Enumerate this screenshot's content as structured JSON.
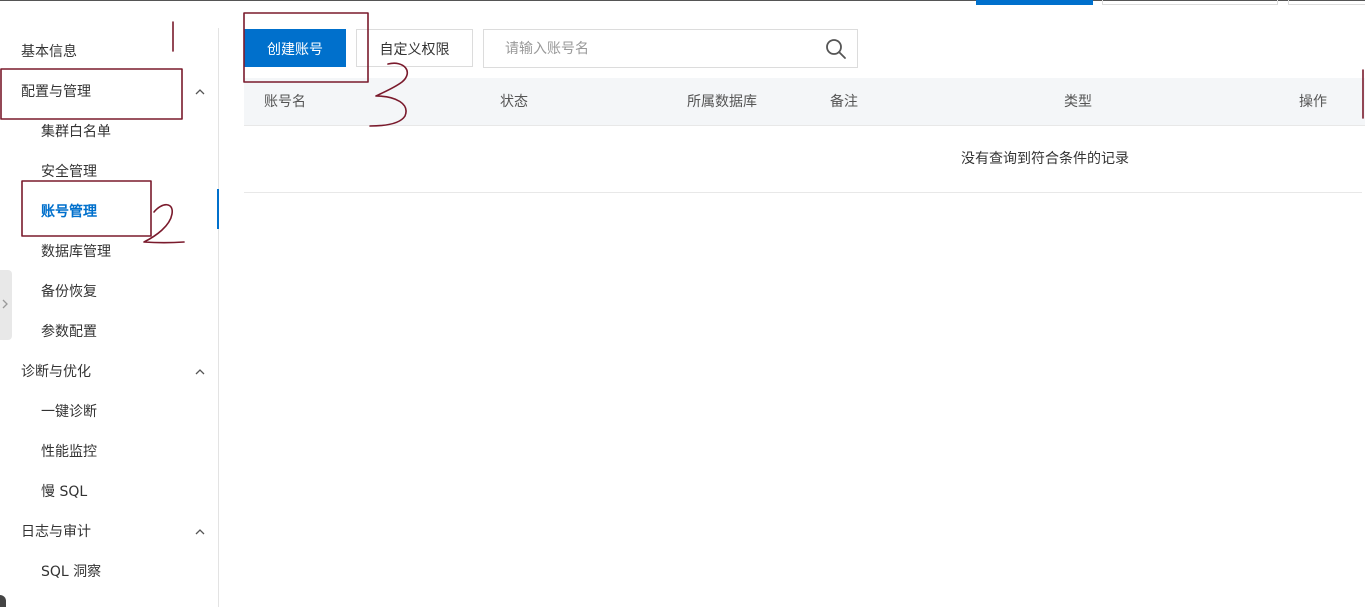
{
  "sidebar": {
    "items": [
      {
        "label": "基本信息",
        "level": 0
      },
      {
        "label": "配置与管理",
        "level": 0,
        "expanded": true
      },
      {
        "label": "集群白名单",
        "level": 1
      },
      {
        "label": "安全管理",
        "level": 1
      },
      {
        "label": "账号管理",
        "level": 1,
        "active": true
      },
      {
        "label": "数据库管理",
        "level": 1
      },
      {
        "label": "备份恢复",
        "level": 1
      },
      {
        "label": "参数配置",
        "level": 1
      },
      {
        "label": "诊断与优化",
        "level": 0,
        "expanded": true
      },
      {
        "label": "一键诊断",
        "level": 1
      },
      {
        "label": "性能监控",
        "level": 1
      },
      {
        "label": "慢 SQL",
        "level": 1
      },
      {
        "label": "日志与审计",
        "level": 0,
        "expanded": true
      },
      {
        "label": "SQL 洞察",
        "level": 1
      }
    ]
  },
  "toolbar": {
    "create_label": "创建账号",
    "custom_perm_label": "自定义权限",
    "search_placeholder": "请输入账号名"
  },
  "table": {
    "columns": [
      "账号名",
      "状态",
      "所属数据库",
      "备注",
      "类型",
      "操作"
    ],
    "empty_text": "没有查询到符合条件的记录"
  },
  "annotations": {
    "step1": "1",
    "step2": "2",
    "step3": "3"
  },
  "colors": {
    "primary": "#0070cc",
    "annotation": "#7a1a2c",
    "header_bg": "#f4f6f8",
    "border": "#dcdcdc"
  }
}
